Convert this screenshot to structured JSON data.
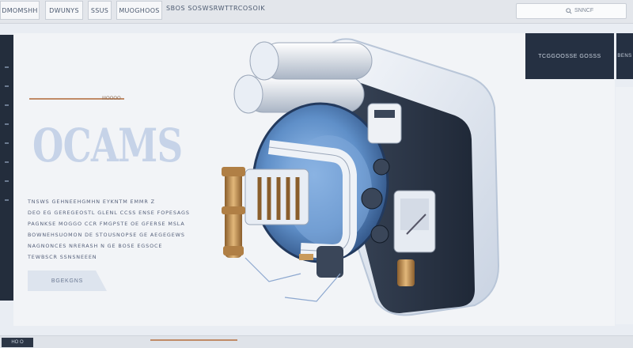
{
  "topbar": {
    "tabs": [
      "DMOMSHH",
      "DWUNYS",
      "SSUS",
      "MUOGHOOS"
    ],
    "breadcrumb": "SBOS SOSWSRWTTRCOSOIK",
    "search_placeholder": "SNNCF"
  },
  "hero": {
    "eyebrow_label": "IIIOOOO",
    "headline": "OCAMS",
    "body_lines": [
      "TNSWS GEHNEEHGMHN EYKNTM EMMR Z",
      "DEO EG GEREGEOSTL GLENL CCSS ENSE FOPESAGS",
      "PAGNKSE MOGGO CCR FMGPSTE OE GFERSE MSLA",
      "BOWNEHSUOMON DE STOUSNOPSE GE AEGEGEWS",
      "NAGNONCES NRERASH N GE BOSE EGSOCE",
      "TEWBSCR SSNSNEEEN"
    ],
    "cta_label": "BGEKGNS"
  },
  "cards": [
    {
      "label": "TCGGOOSSE GOSSS"
    },
    {
      "label": "BENS"
    }
  ],
  "bottombar": {
    "tag": "HO O"
  },
  "colors": {
    "rail": "#232d3c",
    "card": "#253042",
    "accent": "#c08a66",
    "headline": "#c6d3e8",
    "pipe_blue": "#5f8fc8",
    "brass": "#c99a5b"
  },
  "icons": {
    "search": "search-icon",
    "illustration": "engine-illustration"
  }
}
